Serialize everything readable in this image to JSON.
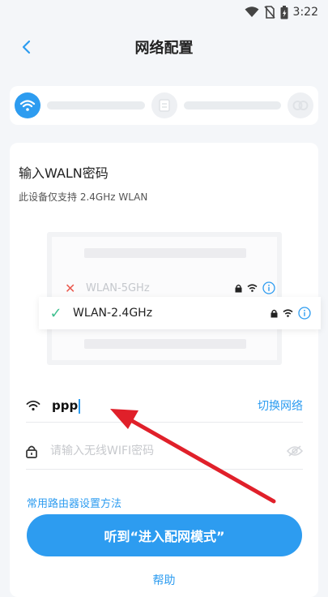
{
  "status_bar": {
    "time": "3:22",
    "icons": [
      "wifi-icon",
      "no-sim-icon",
      "battery-icon"
    ]
  },
  "header": {
    "title": "网络配置",
    "back_icon": "chevron-left-icon"
  },
  "progress": {
    "steps": [
      "wifi-icon",
      "router-icon",
      "link-icon"
    ],
    "current_step": 1
  },
  "card": {
    "title": "输入WALN密码",
    "subtitle": "此设备仅支持 2.4GHz WLAN",
    "illustration": {
      "rows": [
        {
          "label": "WLAN-5GHz",
          "supported": false
        },
        {
          "label": "WLAN-2.4GHz",
          "supported": true
        }
      ]
    },
    "ssid": {
      "value": "ppp",
      "switch_label": "切换网络"
    },
    "password": {
      "placeholder": "请输入无线WIFI密码",
      "value": ""
    },
    "router_link": "常用路由器设置方法",
    "main_button": "听到“进入配网模式”",
    "help": "帮助"
  },
  "colors": {
    "accent": "#2d9cf0",
    "error": "#ea5a4f",
    "success": "#3fbf8f",
    "annotation": "#e0202a"
  }
}
